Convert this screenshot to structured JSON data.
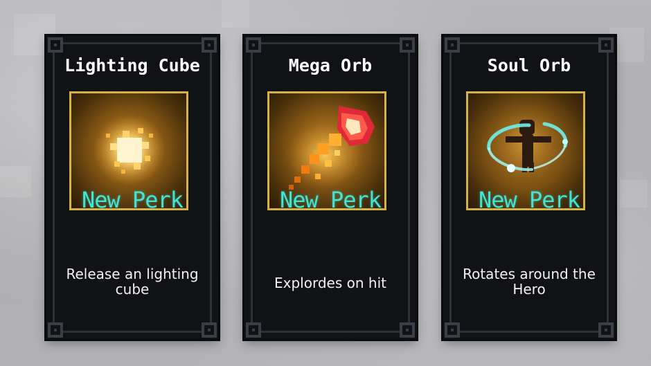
{
  "cards": [
    {
      "title": "Lighting Cube",
      "badge": "New Perk",
      "description": "Release an lighting cube",
      "icon": "lighting-cube-icon"
    },
    {
      "title": "Mega Orb",
      "badge": "New Perk",
      "description": "Explordes on hit",
      "icon": "mega-orb-icon"
    },
    {
      "title": "Soul Orb",
      "badge": "New Perk",
      "description": "Rotates around the Hero",
      "icon": "soul-orb-icon"
    }
  ],
  "colors": {
    "card_bg": "#111216",
    "frame_gold": "#d6b145",
    "badge_cyan": "#43e4d4",
    "title_white": "#ffffff"
  }
}
